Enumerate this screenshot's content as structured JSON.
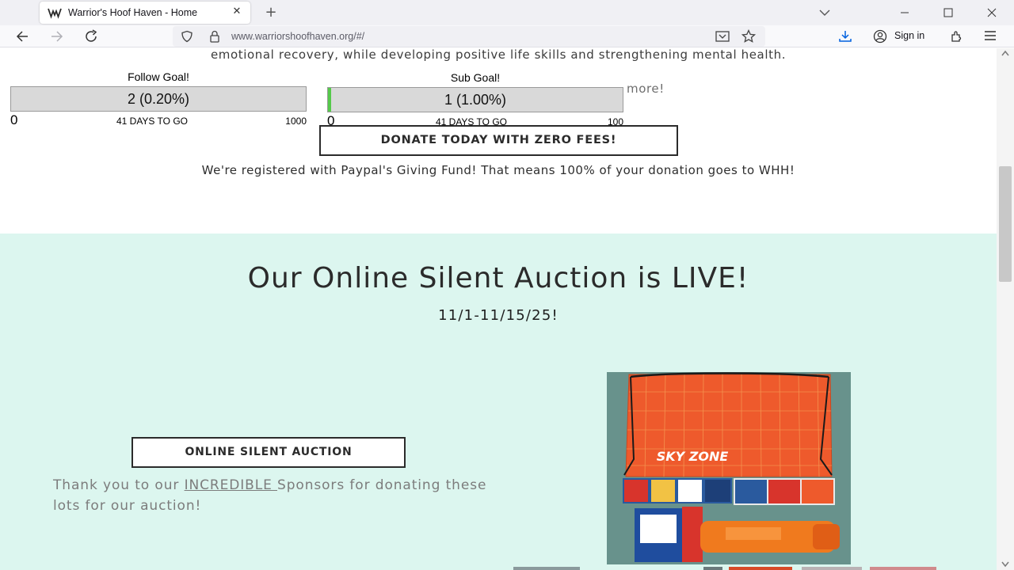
{
  "browser": {
    "tab_title": "Warrior's Hoof Haven - Home",
    "tab_close": "✕",
    "new_tab": "+",
    "url": "www.warriorshoofhaven.org/#/",
    "signin_label": "Sign in",
    "icons": [
      "warriors-hoof-haven-favicon",
      "back-icon",
      "forward-icon",
      "reload-icon",
      "shield-icon",
      "lock-icon",
      "reader-view-icon",
      "star-icon",
      "download-icon",
      "account-icon",
      "extensions-icon",
      "menu-icon",
      "list-tabs-icon",
      "minimize-icon",
      "maximize-icon",
      "close-icon"
    ]
  },
  "page": {
    "intro_text": "emotional recovery, while developing positive life skills and strengthening mental health.",
    "hidden_text": "more!",
    "goals": [
      {
        "title": "Follow Goal!",
        "value_label": "2 (0.20%)",
        "progress_percent": 0.2,
        "min": "0",
        "days_label": "41 DAYS TO GO",
        "max": "1000"
      },
      {
        "title": "Sub Goal!",
        "value_label": "1 (1.00%)",
        "progress_percent": 1.0,
        "min": "0",
        "days_label": "41 DAYS TO GO",
        "max": "100"
      }
    ],
    "donate_button": "DONATE TODAY WITH ZERO FEES!",
    "paypal_text": "We're registered with Paypal's Giving Fund! That means 100% of your donation goes to WHH!",
    "auction": {
      "title": "Our Online Silent Auction is LIVE!",
      "dates": "11/1-11/15/25!",
      "button": "ONLINE SILENT AUCTION",
      "thanks_before": "Thank you to our ",
      "thanks_link": "INCREDIBLE ",
      "thanks_after": "Sponsors for donating these lots for our auction!",
      "image_brand_text": "SKY ZONE"
    }
  },
  "colors": {
    "auction_background": "#dcf6ef",
    "progress_fill": "#55c94a",
    "bar_background": "#d9d9d9",
    "bag_orange": "#ee5a2c"
  }
}
